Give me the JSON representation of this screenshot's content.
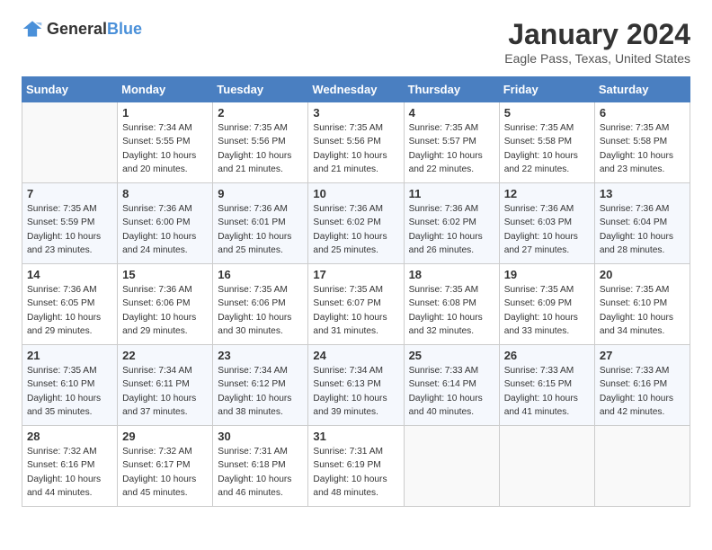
{
  "logo": {
    "general": "General",
    "blue": "Blue"
  },
  "title": "January 2024",
  "subtitle": "Eagle Pass, Texas, United States",
  "weekdays": [
    "Sunday",
    "Monday",
    "Tuesday",
    "Wednesday",
    "Thursday",
    "Friday",
    "Saturday"
  ],
  "weeks": [
    [
      {
        "day": "",
        "sunrise": "",
        "sunset": "",
        "daylight": ""
      },
      {
        "day": "1",
        "sunrise": "Sunrise: 7:34 AM",
        "sunset": "Sunset: 5:55 PM",
        "daylight": "Daylight: 10 hours and 20 minutes."
      },
      {
        "day": "2",
        "sunrise": "Sunrise: 7:35 AM",
        "sunset": "Sunset: 5:56 PM",
        "daylight": "Daylight: 10 hours and 21 minutes."
      },
      {
        "day": "3",
        "sunrise": "Sunrise: 7:35 AM",
        "sunset": "Sunset: 5:56 PM",
        "daylight": "Daylight: 10 hours and 21 minutes."
      },
      {
        "day": "4",
        "sunrise": "Sunrise: 7:35 AM",
        "sunset": "Sunset: 5:57 PM",
        "daylight": "Daylight: 10 hours and 22 minutes."
      },
      {
        "day": "5",
        "sunrise": "Sunrise: 7:35 AM",
        "sunset": "Sunset: 5:58 PM",
        "daylight": "Daylight: 10 hours and 22 minutes."
      },
      {
        "day": "6",
        "sunrise": "Sunrise: 7:35 AM",
        "sunset": "Sunset: 5:58 PM",
        "daylight": "Daylight: 10 hours and 23 minutes."
      }
    ],
    [
      {
        "day": "7",
        "sunrise": "Sunrise: 7:35 AM",
        "sunset": "Sunset: 5:59 PM",
        "daylight": "Daylight: 10 hours and 23 minutes."
      },
      {
        "day": "8",
        "sunrise": "Sunrise: 7:36 AM",
        "sunset": "Sunset: 6:00 PM",
        "daylight": "Daylight: 10 hours and 24 minutes."
      },
      {
        "day": "9",
        "sunrise": "Sunrise: 7:36 AM",
        "sunset": "Sunset: 6:01 PM",
        "daylight": "Daylight: 10 hours and 25 minutes."
      },
      {
        "day": "10",
        "sunrise": "Sunrise: 7:36 AM",
        "sunset": "Sunset: 6:02 PM",
        "daylight": "Daylight: 10 hours and 25 minutes."
      },
      {
        "day": "11",
        "sunrise": "Sunrise: 7:36 AM",
        "sunset": "Sunset: 6:02 PM",
        "daylight": "Daylight: 10 hours and 26 minutes."
      },
      {
        "day": "12",
        "sunrise": "Sunrise: 7:36 AM",
        "sunset": "Sunset: 6:03 PM",
        "daylight": "Daylight: 10 hours and 27 minutes."
      },
      {
        "day": "13",
        "sunrise": "Sunrise: 7:36 AM",
        "sunset": "Sunset: 6:04 PM",
        "daylight": "Daylight: 10 hours and 28 minutes."
      }
    ],
    [
      {
        "day": "14",
        "sunrise": "Sunrise: 7:36 AM",
        "sunset": "Sunset: 6:05 PM",
        "daylight": "Daylight: 10 hours and 29 minutes."
      },
      {
        "day": "15",
        "sunrise": "Sunrise: 7:36 AM",
        "sunset": "Sunset: 6:06 PM",
        "daylight": "Daylight: 10 hours and 29 minutes."
      },
      {
        "day": "16",
        "sunrise": "Sunrise: 7:35 AM",
        "sunset": "Sunset: 6:06 PM",
        "daylight": "Daylight: 10 hours and 30 minutes."
      },
      {
        "day": "17",
        "sunrise": "Sunrise: 7:35 AM",
        "sunset": "Sunset: 6:07 PM",
        "daylight": "Daylight: 10 hours and 31 minutes."
      },
      {
        "day": "18",
        "sunrise": "Sunrise: 7:35 AM",
        "sunset": "Sunset: 6:08 PM",
        "daylight": "Daylight: 10 hours and 32 minutes."
      },
      {
        "day": "19",
        "sunrise": "Sunrise: 7:35 AM",
        "sunset": "Sunset: 6:09 PM",
        "daylight": "Daylight: 10 hours and 33 minutes."
      },
      {
        "day": "20",
        "sunrise": "Sunrise: 7:35 AM",
        "sunset": "Sunset: 6:10 PM",
        "daylight": "Daylight: 10 hours and 34 minutes."
      }
    ],
    [
      {
        "day": "21",
        "sunrise": "Sunrise: 7:35 AM",
        "sunset": "Sunset: 6:10 PM",
        "daylight": "Daylight: 10 hours and 35 minutes."
      },
      {
        "day": "22",
        "sunrise": "Sunrise: 7:34 AM",
        "sunset": "Sunset: 6:11 PM",
        "daylight": "Daylight: 10 hours and 37 minutes."
      },
      {
        "day": "23",
        "sunrise": "Sunrise: 7:34 AM",
        "sunset": "Sunset: 6:12 PM",
        "daylight": "Daylight: 10 hours and 38 minutes."
      },
      {
        "day": "24",
        "sunrise": "Sunrise: 7:34 AM",
        "sunset": "Sunset: 6:13 PM",
        "daylight": "Daylight: 10 hours and 39 minutes."
      },
      {
        "day": "25",
        "sunrise": "Sunrise: 7:33 AM",
        "sunset": "Sunset: 6:14 PM",
        "daylight": "Daylight: 10 hours and 40 minutes."
      },
      {
        "day": "26",
        "sunrise": "Sunrise: 7:33 AM",
        "sunset": "Sunset: 6:15 PM",
        "daylight": "Daylight: 10 hours and 41 minutes."
      },
      {
        "day": "27",
        "sunrise": "Sunrise: 7:33 AM",
        "sunset": "Sunset: 6:16 PM",
        "daylight": "Daylight: 10 hours and 42 minutes."
      }
    ],
    [
      {
        "day": "28",
        "sunrise": "Sunrise: 7:32 AM",
        "sunset": "Sunset: 6:16 PM",
        "daylight": "Daylight: 10 hours and 44 minutes."
      },
      {
        "day": "29",
        "sunrise": "Sunrise: 7:32 AM",
        "sunset": "Sunset: 6:17 PM",
        "daylight": "Daylight: 10 hours and 45 minutes."
      },
      {
        "day": "30",
        "sunrise": "Sunrise: 7:31 AM",
        "sunset": "Sunset: 6:18 PM",
        "daylight": "Daylight: 10 hours and 46 minutes."
      },
      {
        "day": "31",
        "sunrise": "Sunrise: 7:31 AM",
        "sunset": "Sunset: 6:19 PM",
        "daylight": "Daylight: 10 hours and 48 minutes."
      },
      {
        "day": "",
        "sunrise": "",
        "sunset": "",
        "daylight": ""
      },
      {
        "day": "",
        "sunrise": "",
        "sunset": "",
        "daylight": ""
      },
      {
        "day": "",
        "sunrise": "",
        "sunset": "",
        "daylight": ""
      }
    ]
  ]
}
